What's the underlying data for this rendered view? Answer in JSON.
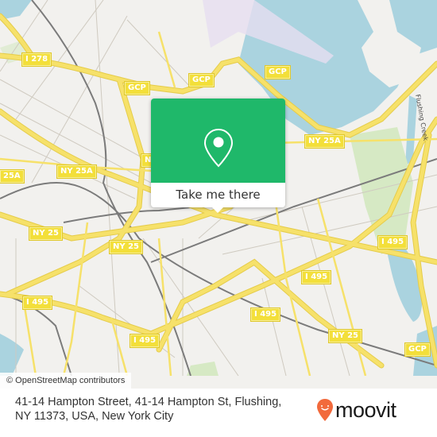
{
  "map": {
    "road_labels": [
      {
        "id": "i278",
        "text": "I 278"
      },
      {
        "id": "gcp-1",
        "text": "GCP"
      },
      {
        "id": "gcp-2",
        "text": "GCP"
      },
      {
        "id": "gcp-3",
        "text": "GCP"
      },
      {
        "id": "gcp-4",
        "text": "GCP"
      },
      {
        "id": "ny25a-1",
        "text": "NY 25A"
      },
      {
        "id": "ny25a-2",
        "text": "NY 25A"
      },
      {
        "id": "ny25a-3",
        "text": "25A"
      },
      {
        "id": "ny25a-4",
        "text": "NY 25A"
      },
      {
        "id": "ny25-1",
        "text": "NY 25"
      },
      {
        "id": "ny25-2",
        "text": "NY 25"
      },
      {
        "id": "ny25-3",
        "text": "NY 25"
      },
      {
        "id": "i495-1",
        "text": "I 495"
      },
      {
        "id": "i495-2",
        "text": "I 495"
      },
      {
        "id": "i495-3",
        "text": "I 495"
      },
      {
        "id": "i495-4",
        "text": "I 495"
      }
    ],
    "water_labels": [
      {
        "text": "Flushing Creek"
      }
    ],
    "colors": {
      "land": "#f2f1ee",
      "water": "#aad3df",
      "park": "#d6e9c4",
      "highway": "#f6e16a",
      "highway_edge": "#e5cc4a",
      "minor_road": "#c8c4bb",
      "rail": "#777777",
      "airport": "#e6dff0"
    }
  },
  "popup": {
    "cta_label": "Take me there",
    "icon": "location-pin-icon",
    "color": "#1fb86a"
  },
  "attribution": "© OpenStreetMap contributors",
  "footer": {
    "address_line1": "41-14 Hampton Street, 41-14 Hampton St, Flushing,",
    "address_line2": "NY 11373, USA, New York City",
    "logo_text": "moovit",
    "logo_color": "#f26a3c"
  }
}
